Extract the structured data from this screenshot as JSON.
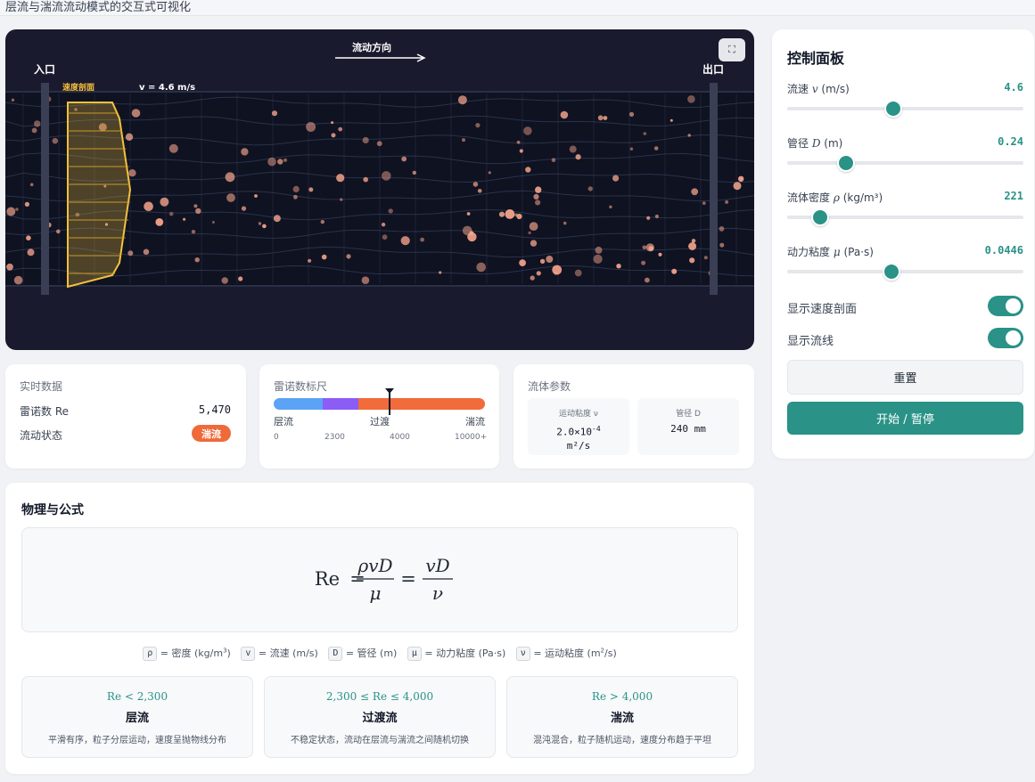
{
  "page": {
    "title": "层流与湍流流动模式的交互式可视化"
  },
  "viz": {
    "inlet_label": "入口",
    "outlet_label": "出口",
    "flow_direction_label": "流动方向",
    "profile_label": "速度剖面",
    "velocity_readout": "v = 4.6 m/s",
    "fullscreen_icon": "⛶",
    "colors": {
      "background": "#1a1a2e",
      "particle": "#f4a48c",
      "profile": "#f5c13c"
    }
  },
  "panel": {
    "title": "控制面板",
    "velocity": {
      "label_prefix": "流速 ",
      "label_var": "v",
      "label_unit": " (m/s)",
      "value": "4.6",
      "fraction": 0.45
    },
    "diameter": {
      "label_prefix": "管径 ",
      "label_var": "D",
      "label_unit": " (m)",
      "value": "0.24",
      "fraction": 0.25
    },
    "density": {
      "label_prefix": "流体密度 ",
      "label_var": "ρ",
      "label_unit": " (kg/m³)",
      "value": "221",
      "fraction": 0.14
    },
    "viscosity": {
      "label_prefix": "动力粘度 ",
      "label_var": "μ",
      "label_unit": " (Pa·s)",
      "value": "0.0446",
      "fraction": 0.44
    },
    "toggle_profile": "显示速度剖面",
    "toggle_streamlines": "显示流线",
    "reset_label": "重置",
    "start_label": "开始 / 暂停",
    "accent": "#2a9287"
  },
  "realtime": {
    "title": "实时数据",
    "reynolds_label": "雷诺数 Re",
    "reynolds_value": "5,470",
    "state_label": "流动状态",
    "state_badge": "湍流",
    "badge_color": "#ef6a3a"
  },
  "scale": {
    "title": "雷诺数标尺",
    "zone_laminar": "层流",
    "zone_transition": "过渡",
    "zone_turbulent": "湍流",
    "ticks": [
      "0",
      "2300",
      "4000",
      "10000+"
    ],
    "marker_value": 5470,
    "colors": {
      "laminar": "#5ba3f5",
      "transition": "#8b5cf6",
      "turbulent": "#f26b3a"
    }
  },
  "fluid": {
    "title": "流体参数",
    "kinematic_label": "运动粘度 ν",
    "kinematic_mantissa": "2.0×10",
    "kinematic_exp": "-4",
    "kinematic_unit": "m²/s",
    "diameter_label": "管径 D",
    "diameter_value": "240 mm"
  },
  "physics": {
    "title": "物理与公式",
    "formula_lhs": "Re",
    "formula_num1": "ρvD",
    "formula_den1": "μ",
    "formula_num2": "vD",
    "formula_den2": "ν",
    "legend": {
      "rho_sym": "ρ",
      "rho_txt": " = 密度 (kg/m",
      "v_sym": "v",
      "v_txt": " = 流速 (m/s)",
      "d_sym": "D",
      "d_txt": " = 管径 (m)",
      "mu_sym": "μ",
      "mu_txt": " = 动力粘度 (Pa·s)",
      "nu_sym": "ν",
      "nu_txt": " = 运动粘度 (m",
      "nu_tail": "/s)"
    },
    "regimes": [
      {
        "cond": "Re < 2,300",
        "name": "层流",
        "desc": "平滑有序，粒子分层运动，速度呈抛物线分布"
      },
      {
        "cond": "2,300 ≤ Re ≤ 4,000",
        "name": "过渡流",
        "desc": "不稳定状态，流动在层流与湍流之间随机切换"
      },
      {
        "cond": "Re > 4,000",
        "name": "湍流",
        "desc": "混沌混合，粒子随机运动，速度分布趋于平坦"
      }
    ]
  }
}
